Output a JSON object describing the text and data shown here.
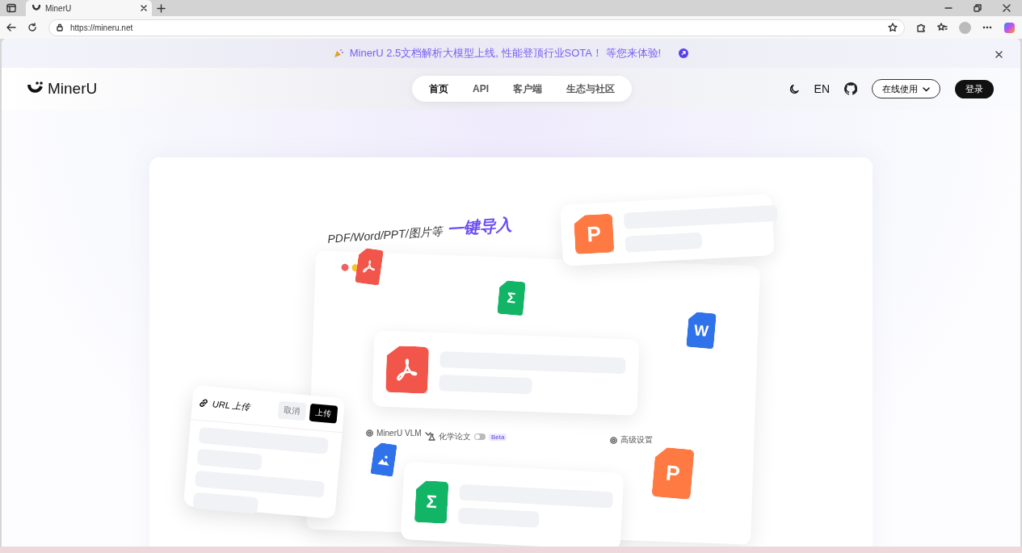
{
  "browser": {
    "tab_title": "MinerU",
    "url": "https://mineru.net"
  },
  "banner": {
    "text": "MinerU 2.5文档解析大模型上线, 性能登顶行业SOTA！ 等您来体验!"
  },
  "nav": {
    "logo": "MinerU",
    "links": [
      {
        "label": "首页",
        "selected": true
      },
      {
        "label": "API",
        "selected": false
      },
      {
        "label": "客户端",
        "selected": false
      },
      {
        "label": "生态与社区",
        "selected": false
      }
    ],
    "language": "EN",
    "online_button": "在线使用",
    "login_button": "登录"
  },
  "illustration": {
    "headline": "PDF/Word/PPT/图片等",
    "highlight": "一键导入",
    "cards": [
      {
        "kind": "ppt",
        "letter": "P"
      },
      {
        "kind": "pdf"
      },
      {
        "kind": "sheet",
        "letter": "Σ"
      }
    ],
    "floating_icons": [
      {
        "kind": "pdf"
      },
      {
        "kind": "sheet",
        "letter": "Σ"
      },
      {
        "kind": "word",
        "letter": "W"
      },
      {
        "kind": "image"
      },
      {
        "kind": "ppt",
        "letter": "P"
      }
    ],
    "url_panel": {
      "title": "URL 上传",
      "cancel": "取消",
      "upload": "上传"
    },
    "model_select": "MinerU VLM",
    "chem_toggle": {
      "label": "化学论文",
      "on": false
    },
    "beta": "Beta",
    "advanced": "高级设置"
  }
}
